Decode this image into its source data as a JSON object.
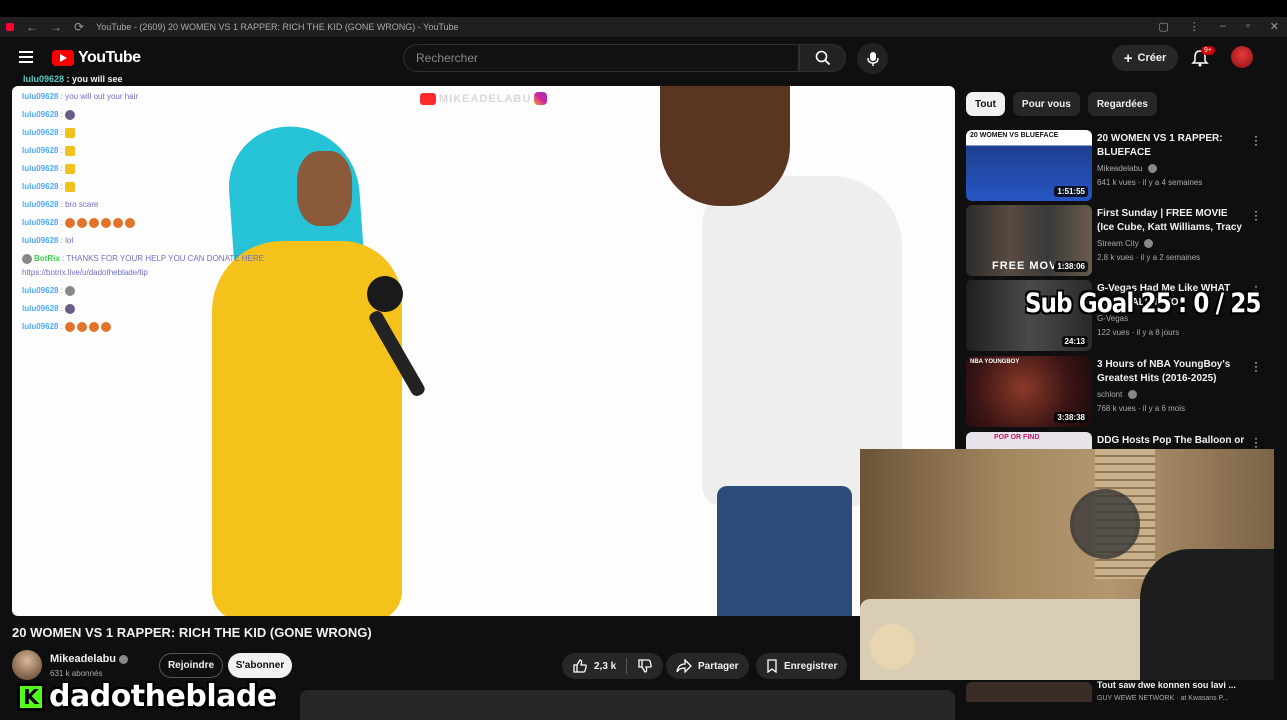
{
  "browser": {
    "page_title": "YouTube - (2609) 20 WOMEN VS 1 RAPPER: RICH THE KID (GONE WRONG) - YouTube"
  },
  "header": {
    "logo_text": "YouTube",
    "search_placeholder": "Rechercher",
    "create_label": "Créer",
    "notifications_count": "9+"
  },
  "chat_overlay": {
    "top_user": "lulu09628",
    "top_message": ": you will see",
    "lines": [
      {
        "user": "lulu09628",
        "message": ": you will out your hair"
      },
      {
        "user": "lulu09628",
        "message": ":"
      },
      {
        "user": "lulu09628",
        "message": ":"
      },
      {
        "user": "lulu09628",
        "message": ":"
      },
      {
        "user": "lulu09628",
        "message": ":"
      },
      {
        "user": "lulu09628",
        "message": ":"
      },
      {
        "user": "lulu09628",
        "message": ": bro scare"
      },
      {
        "user": "lulu09628",
        "message": ":"
      },
      {
        "user": "lulu09628",
        "message": ": lol"
      },
      {
        "user": "BotRix",
        "message": ": THANKS FOR YOUR HELP YOU CAN DONATE HERE"
      },
      {
        "user": "",
        "message": "https://botrix.live/u/dadotheblade/tip"
      },
      {
        "user": "lulu09628",
        "message": ":"
      },
      {
        "user": "lulu09628",
        "message": ":"
      },
      {
        "user": "lulu09628",
        "message": ":"
      }
    ]
  },
  "video": {
    "watermark_text": "MIKEADELABU",
    "title": "20 WOMEN VS 1 RAPPER: RICH THE KID (GONE WRONG)",
    "channel_name": "Mikeadelabu",
    "subscribers": "631 k abonnés",
    "join_label": "Rejoindre",
    "subscribe_label": "S'abonner",
    "likes": "2,3 k",
    "share_label": "Partager",
    "save_label": "Enregistrer"
  },
  "streamer_overlay": {
    "name": "dadotheblade",
    "platform_letter": "K",
    "sub_goal_text": "Sub Goal 25 : 0 / 25"
  },
  "chips": [
    "Tout",
    "Pour vous",
    "Regardées"
  ],
  "recommendations": [
    {
      "title": "20 WOMEN VS 1 RAPPER: BLUEFACE",
      "channel": "Mikeadelabu",
      "meta": "641 k vues · il y a 4 semaines",
      "duration": "1:51:55",
      "thumb_label": "20 WOMEN VS BLUEFACE"
    },
    {
      "title": "First Sunday | FREE MOVIE (Ice Cube, Katt Williams, Tracy ...",
      "channel": "Stream City",
      "meta": "2,8 k vues · il y a 2 semaines",
      "duration": "1:38:06",
      "thumb_label": "FREE MOVIE"
    },
    {
      "title": "G-Vegas Had Me Like WHAT DID I WALK INTO",
      "channel": "G-Vegas",
      "meta": "122 vues · il y a 8 jours",
      "duration": "24:13",
      "thumb_label": ""
    },
    {
      "title": "3 Hours of NBA YoungBoy's Greatest Hits (2016-2025)",
      "channel": "schlont",
      "meta": "768 k vues · il y a 6 mois",
      "duration": "3:38:38",
      "thumb_label": "NBA YOUNGBOY"
    },
    {
      "title": "DDG Hosts Pop The Balloon or",
      "channel": "",
      "meta": "",
      "duration": "",
      "thumb_label": "POP OR FIND"
    }
  ],
  "bottom_recommendation": {
    "title": "Tout saw dwe konnen sou lavi ...",
    "channel": "GUY WEWE NETWORK · at Kwasans P..."
  }
}
